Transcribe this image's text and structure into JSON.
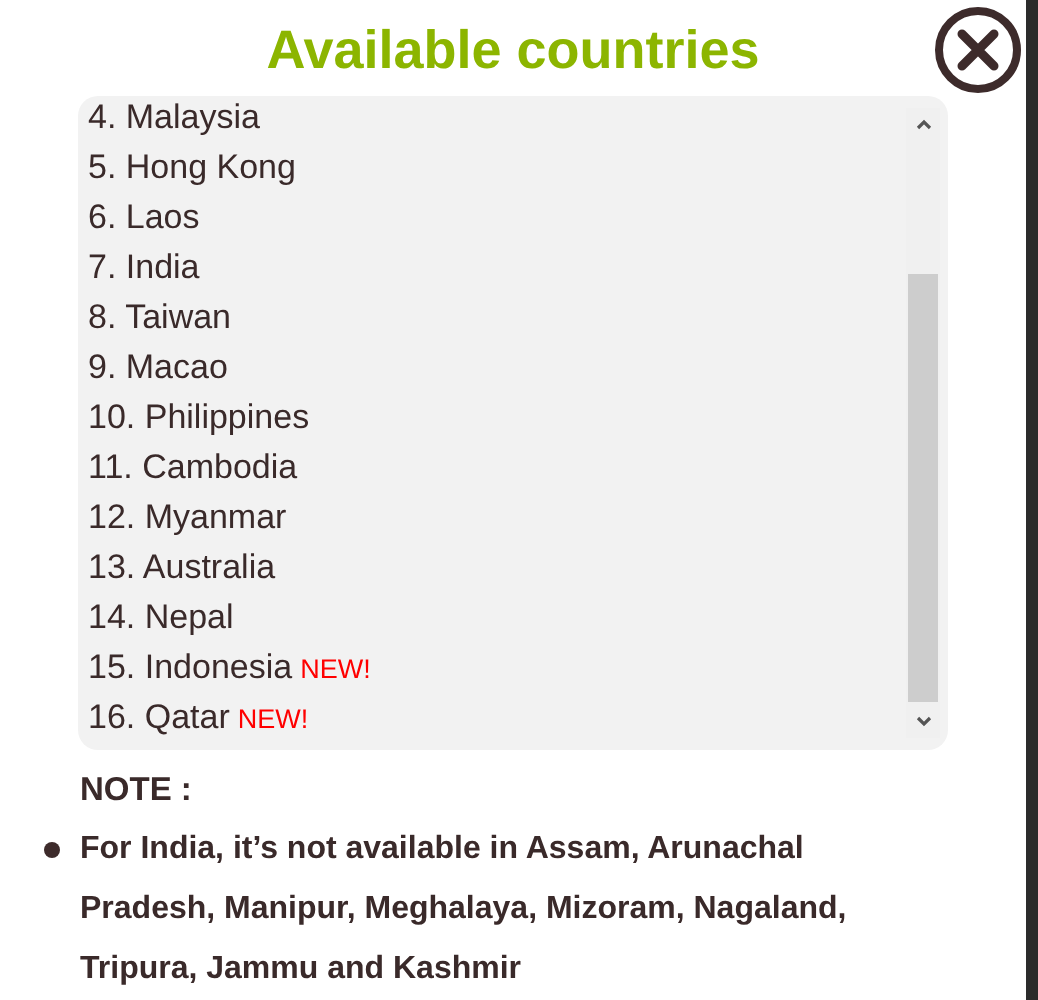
{
  "dialog": {
    "title": "Available countries"
  },
  "countries": [
    {
      "label": "4. Malaysia"
    },
    {
      "label": "5. Hong Kong"
    },
    {
      "label": "6. Laos"
    },
    {
      "label": "7. India"
    },
    {
      "label": "8. Taiwan"
    },
    {
      "label": "9. Macao"
    },
    {
      "label": "10. Philippines"
    },
    {
      "label": "11. Cambodia"
    },
    {
      "label": "12. Myanmar"
    },
    {
      "label": "13. Australia"
    },
    {
      "label": "14. Nepal"
    },
    {
      "label": "15. Indonesia",
      "badge": "NEW!"
    },
    {
      "label": "16. Qatar",
      "badge": "NEW!"
    }
  ],
  "note": {
    "heading": "NOTE :",
    "items": [
      "For India, it’s not available in Assam, Arunachal Pradesh, Manipur, Meghalaya, Mizoram, Nagaland, Tripura, Jammu and Kashmir"
    ]
  }
}
